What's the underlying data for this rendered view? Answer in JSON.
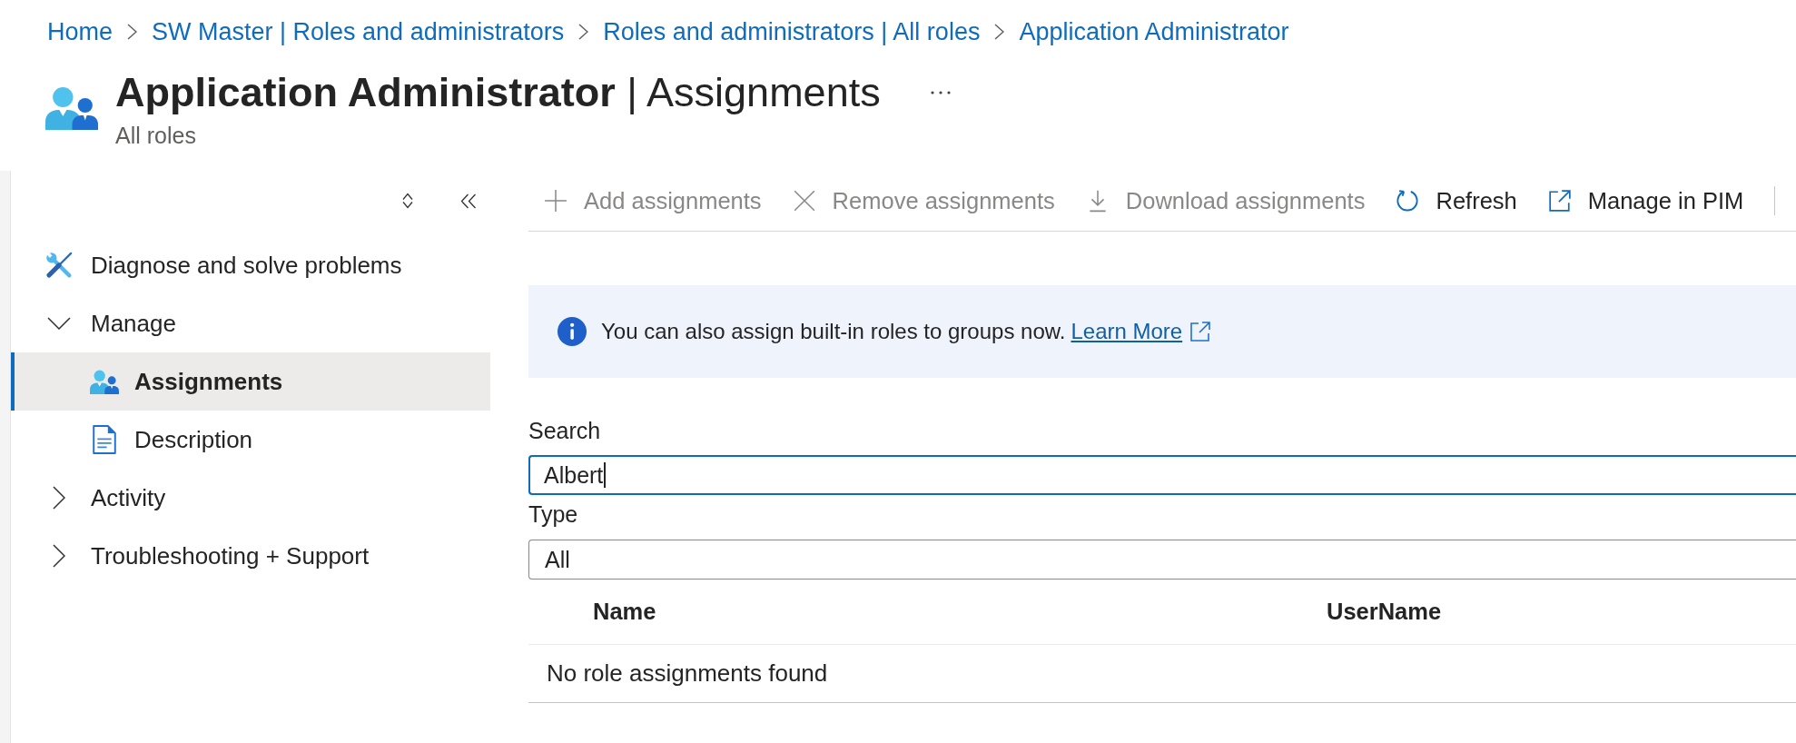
{
  "breadcrumb": [
    "Home",
    "SW Master | Roles and administrators",
    "Roles and administrators | All roles",
    "Application Administrator"
  ],
  "header": {
    "title": "**Application Administrator** | Assignments",
    "subtitle": "All roles"
  },
  "sidebar": {
    "items": [
      {
        "kind": "link",
        "label": "Diagnose and solve problems",
        "selected": false
      },
      {
        "kind": "group",
        "label": "Manage",
        "expanded": true,
        "children": [
          {
            "kind": "link",
            "label": "Assignments",
            "selected": true
          },
          {
            "kind": "link",
            "label": "Description",
            "selected": false
          }
        ]
      },
      {
        "kind": "group",
        "label": "Activity",
        "expanded": false
      },
      {
        "kind": "group",
        "label": "Troubleshooting + Support",
        "expanded": false
      }
    ]
  },
  "toolbar": {
    "buttons": [
      {
        "label": "Add assignments",
        "disabled": true
      },
      {
        "label": "Remove assignments",
        "disabled": true
      },
      {
        "label": "Download assignments",
        "disabled": true
      },
      {
        "label": "Refresh",
        "disabled": false
      },
      {
        "label": "Manage in PIM",
        "disabled": false
      }
    ]
  },
  "info_banner": {
    "message": "You can also assign built-in roles to groups now.",
    "link": "Learn More"
  },
  "filters": [
    {
      "label": "Search",
      "value": "Albert",
      "focused": true
    },
    {
      "label": "Type",
      "value": "All",
      "focused": false
    }
  ],
  "table": {
    "columns": [
      "Name",
      "UserName"
    ],
    "empty_message": "No role assignments found"
  }
}
